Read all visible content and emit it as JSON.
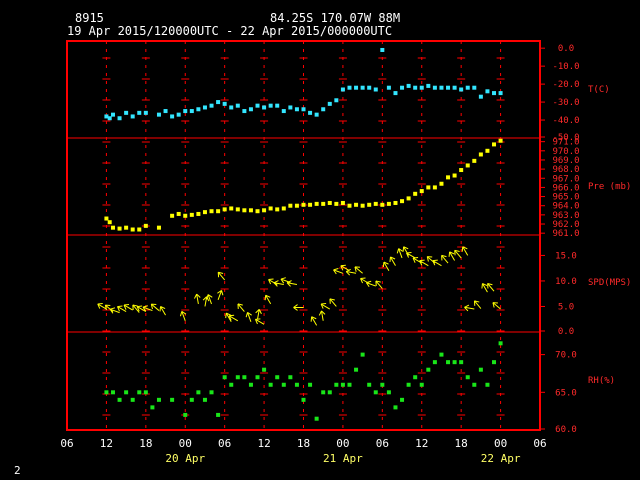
{
  "header": {
    "station_id": "8915",
    "location": "84.25S   170.07W    88M",
    "time_range": "19 Apr 2015/120000UTC - 22 Apr 2015/000000UTC"
  },
  "footer": {
    "page_number": "2"
  },
  "colors": {
    "frame": "#ff0000",
    "grid": "#ff0000",
    "temperature": "#33e6ff",
    "pressure": "#ffff00",
    "wind": "#ffff00",
    "humidity": "#19e619",
    "axis_labels": "#ff2a2a",
    "hour_labels": "#ffffff",
    "date_labels": "#ffff66"
  },
  "chart_data": [
    {
      "type": "scatter",
      "panel": "temperature",
      "ylabel": "T(C)",
      "yticks": [
        "0.0",
        "-10.0",
        "-20.0",
        "-30.0",
        "-40.0",
        "-50.0"
      ],
      "ylim": [
        -50,
        4
      ],
      "x_hours": [
        0,
        0.5,
        1,
        2,
        3,
        4,
        5,
        6,
        8,
        9,
        10,
        11,
        12,
        13,
        14,
        15,
        16,
        17,
        18,
        19,
        20,
        21,
        22,
        23,
        24,
        25,
        26,
        27,
        28,
        29,
        30,
        31,
        32,
        33,
        34,
        35,
        36,
        37,
        38,
        39,
        40,
        41,
        42,
        43,
        44,
        45,
        46,
        47,
        48,
        49,
        50,
        51,
        52,
        53,
        54,
        55,
        56,
        57,
        58,
        59,
        60
      ],
      "values": [
        -38,
        -39,
        -37,
        -39,
        -36,
        -38,
        -36,
        -36,
        -37,
        -35,
        -38,
        -37,
        -35,
        -35,
        -34,
        -33,
        -32,
        -30,
        -31,
        -33,
        -32,
        -35,
        -34,
        -32,
        -33,
        -32,
        -32,
        -35,
        -33,
        -34,
        -34,
        -36,
        -37,
        -34,
        -31,
        -29,
        -23,
        -22,
        -22,
        -22,
        -22,
        -23,
        -1,
        -22,
        -25,
        -22,
        -21,
        -22,
        -22,
        -21,
        -22,
        -22,
        -22,
        -22,
        -23,
        -22,
        -22,
        -27,
        -24,
        -25,
        -25
      ]
    },
    {
      "type": "scatter",
      "panel": "pressure",
      "ylabel": "Pre (mb)",
      "yticks": [
        "971.0",
        "970.0",
        "969.0",
        "968.0",
        "967.0",
        "966.0",
        "965.0",
        "964.0",
        "963.0",
        "962.0",
        "961.0"
      ],
      "ylim": [
        960.8,
        971.4
      ],
      "x_hours": [
        0,
        0.5,
        1,
        2,
        3,
        4,
        5,
        6,
        8,
        10,
        11,
        12,
        13,
        14,
        15,
        16,
        17,
        18,
        19,
        20,
        21,
        22,
        23,
        24,
        25,
        26,
        27,
        28,
        29,
        30,
        31,
        32,
        33,
        34,
        35,
        36,
        37,
        38,
        39,
        40,
        41,
        42,
        43,
        44,
        45,
        46,
        47,
        48,
        49,
        50,
        51,
        52,
        53,
        54,
        55,
        56,
        57,
        58,
        59,
        60
      ],
      "values": [
        962.6,
        962.2,
        961.6,
        961.5,
        961.6,
        961.4,
        961.4,
        961.8,
        961.6,
        962.9,
        963.1,
        962.9,
        963.0,
        963.1,
        963.3,
        963.4,
        963.4,
        963.6,
        963.7,
        963.6,
        963.5,
        963.5,
        963.4,
        963.5,
        963.7,
        963.6,
        963.7,
        964.0,
        964.0,
        964.1,
        964.1,
        964.2,
        964.2,
        964.3,
        964.2,
        964.3,
        964.0,
        964.1,
        964.0,
        964.1,
        964.2,
        964.1,
        964.2,
        964.3,
        964.5,
        964.8,
        965.3,
        965.6,
        966.0,
        966.0,
        966.4,
        967.1,
        967.3,
        967.9,
        968.4,
        968.9,
        969.6,
        970.0,
        970.7,
        971.1
      ]
    },
    {
      "type": "scatter",
      "panel": "wind",
      "ylabel": "SPD(MPS)",
      "yticks": [
        "15.0",
        "10.0",
        "5.0",
        "0.0"
      ],
      "ylim": [
        0,
        19
      ],
      "x_hours": [
        0,
        1,
        2,
        3,
        4,
        5,
        6,
        7,
        8,
        9,
        12,
        14,
        15,
        16,
        17,
        18,
        19,
        20,
        21,
        22,
        23,
        24,
        25,
        26,
        27,
        28,
        29,
        30,
        32,
        33,
        34,
        35,
        36,
        37,
        38,
        39,
        40,
        41,
        42,
        43,
        44,
        45,
        46,
        47,
        48,
        49,
        50,
        51,
        52,
        53,
        54,
        55,
        56,
        57,
        58,
        59,
        60
      ],
      "values": [
        4.5,
        4.0,
        3.8,
        4.0,
        4.3,
        3.8,
        4.0,
        4.2,
        4.2,
        3.3,
        2.2,
        5.5,
        5.0,
        5.5,
        6.3,
        10.2,
        2.0,
        2.2,
        4.0,
        2.0,
        2.5,
        1.5,
        5.5,
        9.3,
        9.3,
        9.7,
        9.3,
        4.8,
        1.3,
        2.2,
        4.5,
        5.0,
        11.5,
        12.0,
        11.5,
        11.5,
        9.5,
        9.0,
        8.5,
        12.0,
        13.0,
        14.5,
        15.0,
        14.5,
        13.5,
        13.0,
        13.5,
        13.0,
        13.5,
        14.0,
        14.5,
        15.0,
        4.5,
        4.6,
        7.8,
        8.0,
        4.5
      ],
      "directions_deg": [
        300,
        310,
        290,
        300,
        300,
        320,
        300,
        290,
        310,
        330,
        340,
        350,
        10,
        340,
        20,
        320,
        330,
        300,
        320,
        340,
        10,
        300,
        330,
        300,
        280,
        290,
        280,
        270,
        330,
        350,
        300,
        320,
        290,
        300,
        280,
        310,
        300,
        290,
        320,
        330,
        330,
        340,
        330,
        300,
        300,
        300,
        310,
        300,
        320,
        330,
        320,
        330,
        280,
        320,
        330,
        320,
        310
      ]
    },
    {
      "type": "scatter",
      "panel": "humidity",
      "ylabel": "RH(%)",
      "yticks": [
        "70.0",
        "65.0",
        "60.0"
      ],
      "ylim": [
        60,
        73
      ],
      "x_hours": [
        0,
        1,
        2,
        3,
        4,
        5,
        6,
        7,
        8,
        10,
        12,
        13,
        14,
        15,
        16,
        17,
        18,
        19,
        20,
        21,
        22,
        23,
        24,
        25,
        26,
        27,
        28,
        29,
        30,
        31,
        32,
        33,
        34,
        35,
        36,
        37,
        38,
        39,
        40,
        41,
        42,
        43,
        44,
        45,
        46,
        47,
        48,
        49,
        50,
        51,
        52,
        53,
        54,
        55,
        56,
        57,
        58,
        59,
        60
      ],
      "values": [
        65,
        65,
        64,
        65,
        64,
        65,
        65,
        63,
        64,
        64,
        62,
        64,
        65,
        64,
        65,
        62,
        67,
        66,
        67,
        67,
        66,
        67,
        68,
        66,
        67,
        66,
        67,
        66,
        64,
        66,
        61.5,
        65,
        65,
        66,
        66,
        66,
        68,
        70,
        66,
        65,
        66,
        65,
        63,
        64,
        66,
        67,
        66,
        68,
        69,
        70,
        69,
        69,
        69,
        67,
        66,
        68,
        66,
        69,
        71.5
      ]
    }
  ],
  "x_axis": {
    "hour_labels": [
      "06",
      "12",
      "18",
      "00",
      "06",
      "12",
      "18",
      "00",
      "06",
      "12",
      "18",
      "00",
      "06"
    ],
    "date_labels": [
      "20 Apr",
      "21 Apr",
      "22 Apr"
    ]
  }
}
